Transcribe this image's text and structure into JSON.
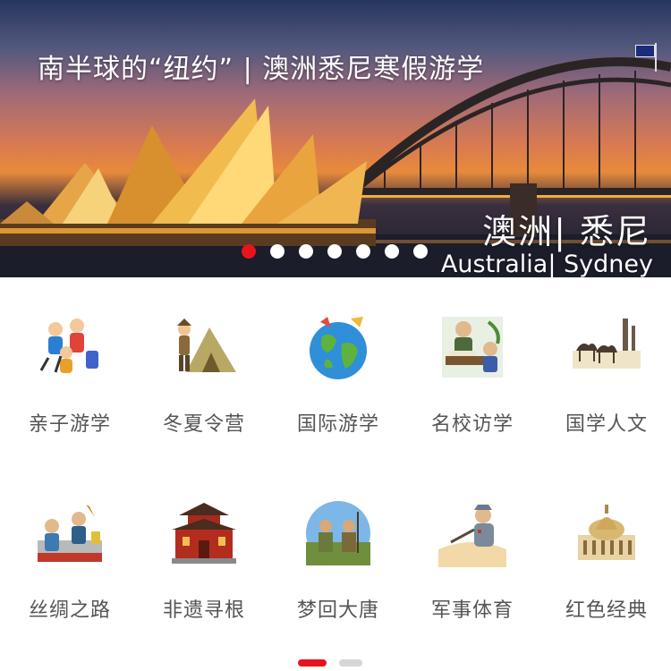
{
  "banner": {
    "title": "南半球的“纽约” | 澳洲悉尼寒假游学",
    "location_cn": "澳洲| 悉尼",
    "location_en": "Australia| Sydney",
    "slide_count": 7,
    "active_slide": 1
  },
  "categories": [
    {
      "label": "亲子游学",
      "icon": "family-travel-icon"
    },
    {
      "label": "冬夏令营",
      "icon": "camp-tent-icon"
    },
    {
      "label": "国际游学",
      "icon": "globe-icon"
    },
    {
      "label": "名校访学",
      "icon": "scholar-study-icon"
    },
    {
      "label": "国学人文",
      "icon": "camel-caravan-icon"
    },
    {
      "label": "丝绸之路",
      "icon": "silk-road-icon"
    },
    {
      "label": "非遗寻根",
      "icon": "chinese-temple-icon"
    },
    {
      "label": "梦回大唐",
      "icon": "tang-soldiers-icon"
    },
    {
      "label": "军事体育",
      "icon": "military-officer-icon"
    },
    {
      "label": "红色经典",
      "icon": "classic-building-icon"
    }
  ],
  "pager": {
    "pages": 2,
    "active_page": 1
  },
  "colors": {
    "accent": "#e8141c",
    "label_text": "#555555",
    "inactive": "#d6d6d6"
  }
}
